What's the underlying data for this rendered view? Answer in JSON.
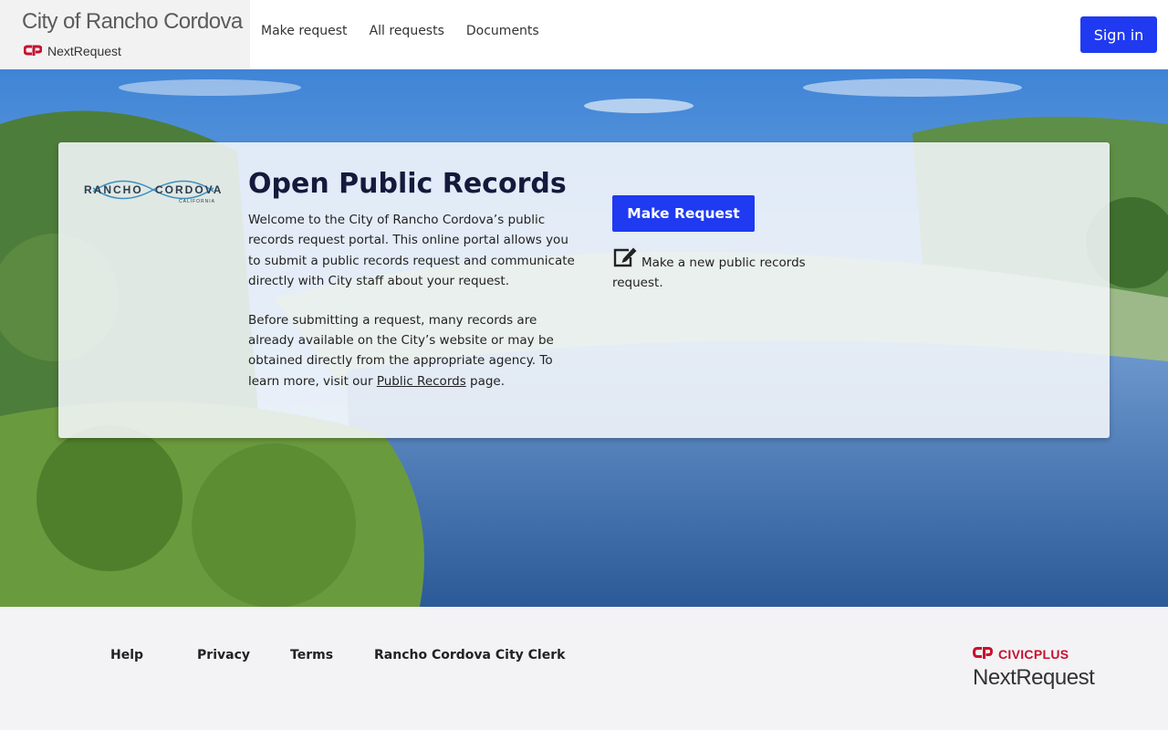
{
  "header": {
    "site_title": "City of Rancho Cordova",
    "product_name": "NextRequest",
    "nav": [
      {
        "label": "Make request"
      },
      {
        "label": "All requests"
      },
      {
        "label": "Documents"
      }
    ],
    "signin_label": "Sign in"
  },
  "hero": {
    "logo": {
      "left": "RANCHO",
      "right": "CORDOVA",
      "sub": "CALIFORNIA"
    },
    "title": "Open Public Records",
    "intro": "Welcome to the City of Rancho Cordova’s public records request portal. This online portal allows you to submit a public records request and communicate directly with City staff about your request.",
    "info_before": "Before submitting a request, many records are already available on the City’s website or may be obtained directly from the appropriate agency. To learn more, visit our ",
    "info_link": "Public Records",
    "info_after": " page.",
    "make_request_label": "Make Request",
    "make_request_desc": "Make a new public records request."
  },
  "footer": {
    "links": [
      {
        "label": "Help"
      },
      {
        "label": "Privacy"
      },
      {
        "label": "Terms"
      },
      {
        "label": "Rancho Cordova City Clerk"
      }
    ],
    "brand_top": "CIVICPLUS",
    "brand_bottom": "NextRequest"
  },
  "colors": {
    "primary": "#1f3af0",
    "civicplus_red": "#c8102e",
    "title_navy": "#141a3c"
  },
  "icons": {
    "nextrequest_logo": "cp-logo-icon",
    "edit": "edit-icon"
  }
}
